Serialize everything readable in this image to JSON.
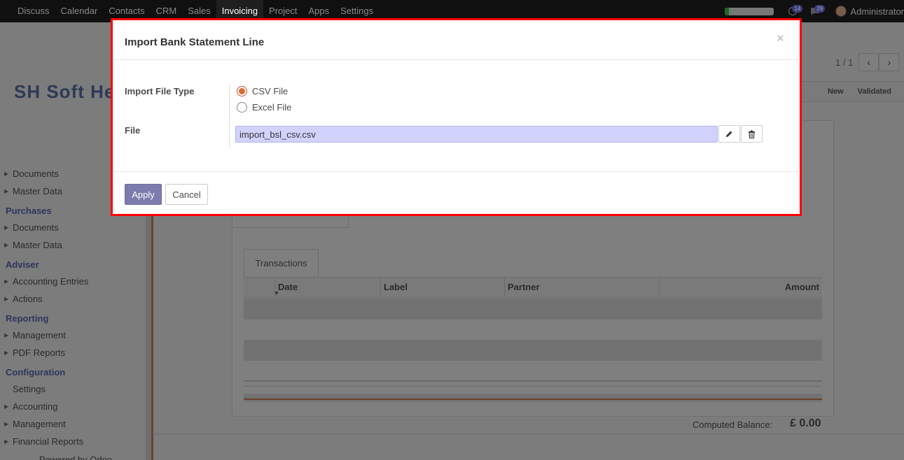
{
  "topbar": {
    "nav": [
      "Discuss",
      "Calendar",
      "Contacts",
      "CRM",
      "Sales",
      "Invoicing",
      "Project",
      "Apps",
      "Settings"
    ],
    "active": "Invoicing",
    "activity_count": "14",
    "message_count": "29",
    "user": "Administrator"
  },
  "background": {
    "logo_text": "SH Soft Hea",
    "pager": {
      "text": "1 / 1",
      "prev_icon": "chevron-left-icon",
      "next_icon": "chevron-right-icon"
    },
    "status": [
      "New",
      "Validated"
    ],
    "sidebar": {
      "items_top": [
        "Documents",
        "Master Data"
      ],
      "sections": [
        {
          "title": "Purchases",
          "items": [
            "Documents",
            "Master Data"
          ]
        },
        {
          "title": "Adviser",
          "items": [
            "Accounting Entries",
            "Actions"
          ]
        },
        {
          "title": "Reporting",
          "items": [
            "Management",
            "PDF Reports"
          ]
        },
        {
          "title": "Configuration",
          "items": [
            "Settings",
            "Accounting",
            "Management",
            "Financial Reports"
          ]
        }
      ],
      "footer": "Powered by Odoo"
    },
    "tab": "Transactions",
    "table_headers": [
      "Date",
      "Label",
      "Partner",
      "Amount"
    ],
    "computed_balance_label": "Computed Balance:",
    "computed_balance_value": "£ 0.00"
  },
  "modal": {
    "title": "Import Bank Statement Line",
    "close_glyph": "×",
    "import_type_label": "Import File Type",
    "options": [
      {
        "label": "CSV File",
        "checked": true
      },
      {
        "label": "Excel File",
        "checked": false
      }
    ],
    "file_label": "File",
    "file_value": "import_bsl_csv.csv",
    "edit_icon": "pencil-icon",
    "delete_icon": "trash-icon",
    "apply_label": "Apply",
    "cancel_label": "Cancel"
  },
  "colors": {
    "highlight_border": "#ff0000",
    "primary_button": "#7c7bad",
    "radio_accent": "#e06a35",
    "file_field_bg": "#d2d2ff"
  }
}
